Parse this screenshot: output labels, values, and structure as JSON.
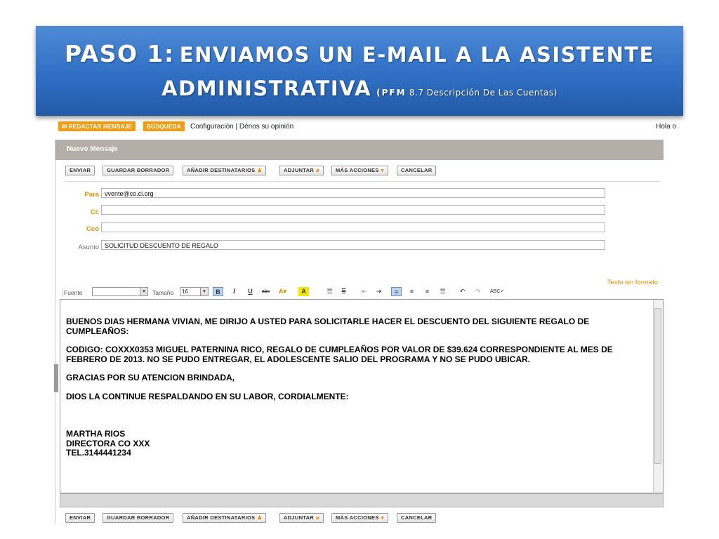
{
  "slide": {
    "title_prefix": "PASO 1:",
    "title_rest": "ENVIAMOS UN E-MAIL A LA ASISTENTE",
    "title_line2": "ADMINISTRATIVA",
    "note_bold": "(PFM",
    "note_rest": "8.7 Descripción De Las Cuentas)"
  },
  "topnav": {
    "compose": "REDACTAR MENSAJE",
    "search": "BÚSQUEDA",
    "links": "Configuración | Dénos su opinión",
    "greeting": "Hola o"
  },
  "compose": {
    "header": "Nuevo Mensaje",
    "buttons": [
      "ENVIAR",
      "GUARDAR BORRADOR",
      "AÑADIR DESTINATARIOS",
      "ADJUNTAR",
      "MÁS ACCIONES",
      "CANCELAR"
    ],
    "labels": {
      "to": "Para",
      "cc": "Cc",
      "bcc": "Cco",
      "subject": "Asunto"
    },
    "to_value": "vvente@co.ci.org",
    "cc_value": "",
    "bcc_value": "",
    "subject_value": "SOLICITUD DESCUENTO DE REGALO",
    "plain_text_link": "Texto sin formato",
    "editor": {
      "font_label": "Fuente",
      "size_label": "Tamaño",
      "size_value": "16"
    }
  },
  "message": {
    "p1": "BUENOS DIAS  HERMANA VIVIAN, ME DIRIJO A USTED PARA  SOLICITARLE HACER EL DESCUENTO DEL SIGUIENTE  REGALO DE CUMPLEAÑOS:",
    "p2": "CODIGO: COXXX0353 MIGUEL PATERNINA RICO, REGALO DE CUMPLEAÑOS  POR VALOR DE $39.624 CORRESPONDIENTE AL MES DE FEBRERO DE 2013. NO SE PUDO ENTREGAR, EL ADOLESCENTE SALIO DEL PROGRAMA Y NO SE PUDO UBICAR.",
    "p3": "GRACIAS POR SU ATENCION BRINDADA,",
    "p4": "DIOS LA CONTINUE RESPALDANDO EN SU LABOR, CORDIALMENTE:",
    "sig1": "MARTHA RIOS",
    "sig2": "DIRECTORA CO XXX",
    "sig3": "TEL.3144441234"
  },
  "icons": [
    "mail-icon",
    "person-icon",
    "paperclip-icon",
    "caret-down-icon",
    "bold-icon",
    "italic-icon",
    "underline-icon",
    "strikethrough-icon",
    "text-color-icon",
    "highlight-icon",
    "ordered-list-icon",
    "bullet-list-icon",
    "outdent-icon",
    "indent-icon",
    "align-left-icon",
    "align-center-icon",
    "align-right-icon",
    "justify-icon",
    "undo-icon",
    "redo-icon",
    "spellcheck-icon"
  ]
}
